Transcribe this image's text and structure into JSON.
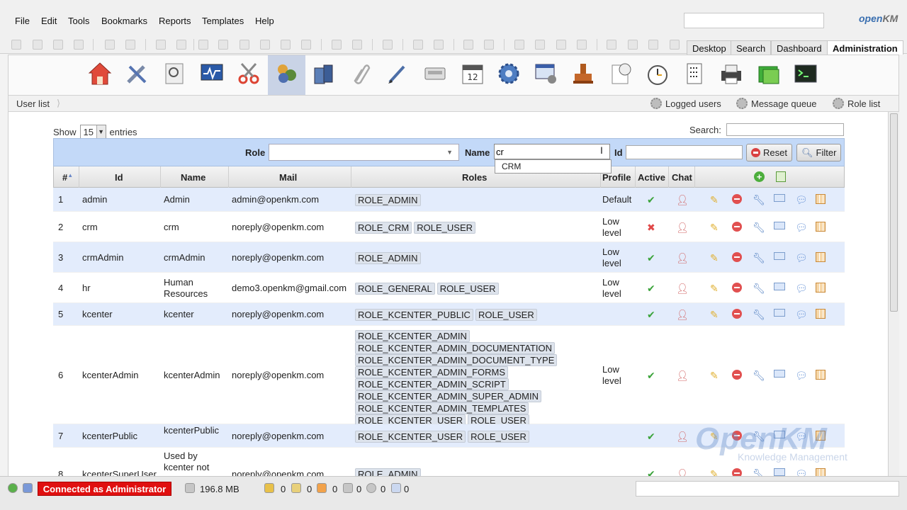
{
  "menubar": {
    "items": [
      "File",
      "Edit",
      "Tools",
      "Bookmarks",
      "Reports",
      "Templates",
      "Help"
    ],
    "logo_a": "open",
    "logo_b": "KM"
  },
  "workspace_tabs": [
    "Desktop",
    "Search",
    "Dashboard",
    "Administration"
  ],
  "subbar": {
    "breadcrumb": "User list",
    "links": [
      "Logged users",
      "Message queue",
      "Role list"
    ]
  },
  "table_controls": {
    "show_label": "Show",
    "entries_value": "15",
    "entries_label": "entries",
    "search_label": "Search:"
  },
  "filters": {
    "role_label": "Role",
    "name_label": "Name",
    "name_value": "cr",
    "id_label": "Id",
    "reset_label": "Reset",
    "filter_label": "Filter",
    "autocomplete_option": "CRM"
  },
  "table": {
    "headers": [
      "#",
      "Id",
      "Name",
      "Mail",
      "Roles",
      "Profile",
      "Active",
      "Chat"
    ],
    "rows": [
      {
        "num": "1",
        "id": "admin",
        "name": "Admin",
        "mail": "admin@openkm.com",
        "roles": [
          "ROLE_ADMIN"
        ],
        "profile": "Default",
        "active": true
      },
      {
        "num": "2",
        "id": "crm",
        "name": "crm",
        "mail": "noreply@openkm.com",
        "roles": [
          "ROLE_CRM",
          "ROLE_USER"
        ],
        "profile": "Low level",
        "active": false
      },
      {
        "num": "3",
        "id": "crmAdmin",
        "name": "crmAdmin",
        "mail": "noreply@openkm.com",
        "roles": [
          "ROLE_ADMIN"
        ],
        "profile": "Low level",
        "active": true
      },
      {
        "num": "4",
        "id": "hr",
        "name": "Human Resources",
        "mail": "demo3.openkm@gmail.com",
        "roles": [
          "ROLE_GENERAL",
          "ROLE_USER"
        ],
        "profile": "Low level",
        "active": true
      },
      {
        "num": "5",
        "id": "kcenter",
        "name": "kcenter",
        "mail": "noreply@openkm.com",
        "roles": [
          "ROLE_KCENTER_PUBLIC",
          "ROLE_USER"
        ],
        "profile": "",
        "active": true
      },
      {
        "num": "6",
        "id": "kcenterAdmin",
        "name": "kcenterAdmin",
        "mail": "noreply@openkm.com",
        "roles": [
          "ROLE_KCENTER_ADMIN",
          "ROLE_KCENTER_ADMIN_DOCUMENTATION",
          "ROLE_KCENTER_ADMIN_DOCUMENT_TYPE",
          "ROLE_KCENTER_ADMIN_FORMS",
          "ROLE_KCENTER_ADMIN_SCRIPT",
          "ROLE_KCENTER_ADMIN_SUPER_ADMIN",
          "ROLE_KCENTER_ADMIN_TEMPLATES",
          "ROLE_KCENTER_USER",
          "ROLE_USER"
        ],
        "profile": "Low level",
        "active": true
      },
      {
        "num": "7",
        "id": "kcenterPublic",
        "name": "kcenterPublic",
        "mail": "noreply@openkm.com",
        "roles": [
          "ROLE_KCENTER_USER",
          "ROLE_USER"
        ],
        "profile": "",
        "active": true
      },
      {
        "num": "8",
        "id": "kcenterSuperUser",
        "name": "Used by kcenter not",
        "mail": "noreply@openkm.com",
        "roles": [
          "ROLE_ADMIN"
        ],
        "profile": "",
        "active": true
      }
    ]
  },
  "watermark": {
    "main": "OpenKM",
    "sub": "Knowledge Management"
  },
  "statusbar": {
    "connected": "Connected as Administrator",
    "memory": "196.8 MB",
    "counts": [
      "0",
      "0",
      "0",
      "0",
      "0",
      "0"
    ]
  },
  "colors": {
    "accent": "#c3d9f8",
    "row_alt": "#e3ecfc",
    "status_red": "#e01010"
  }
}
